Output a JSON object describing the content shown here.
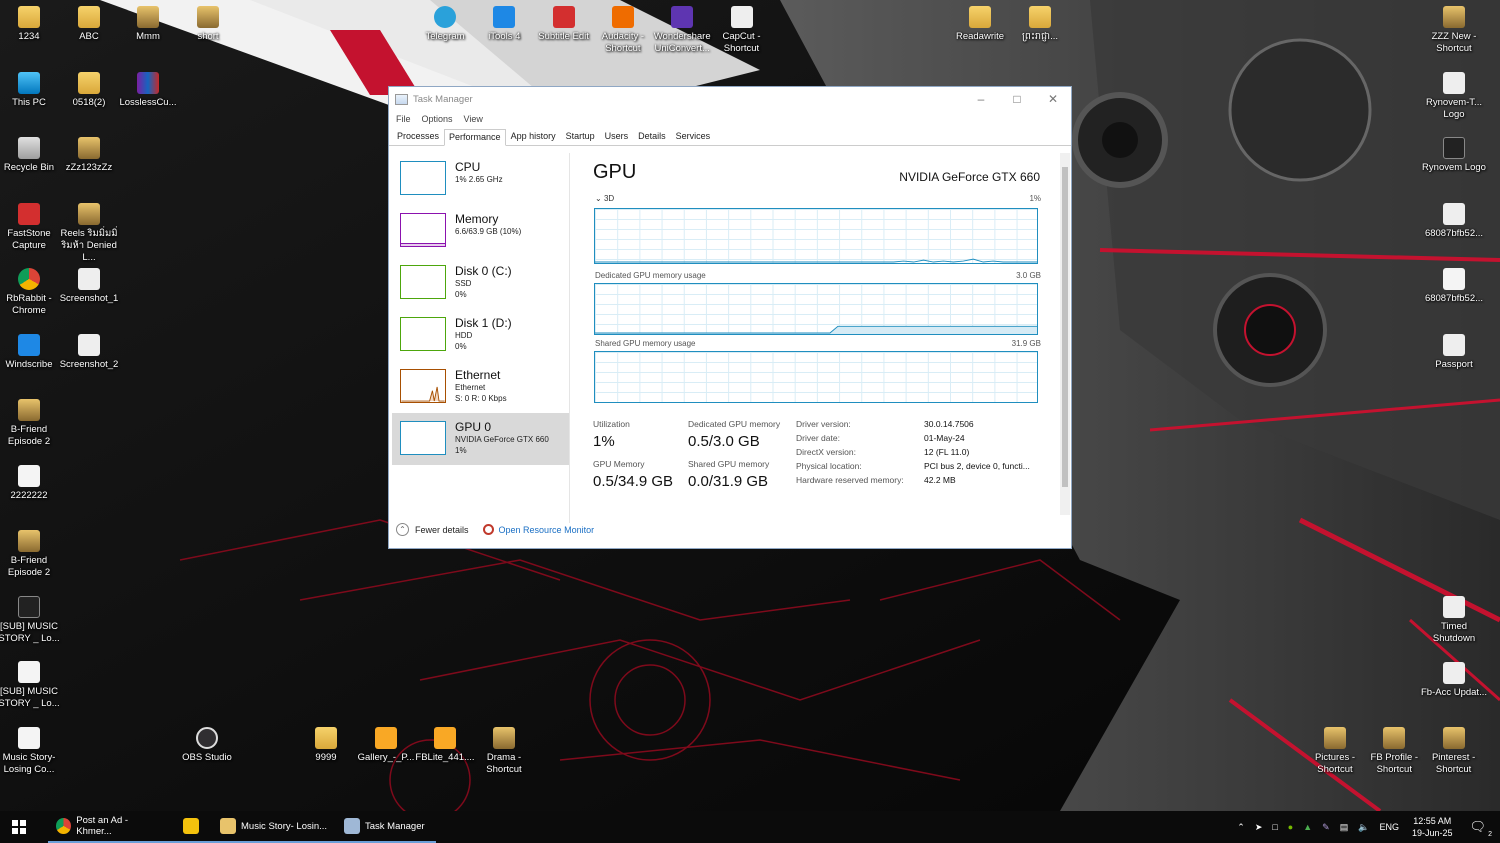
{
  "desktop": {
    "left_icons": [
      {
        "label": "1234",
        "icon": "folder-icon",
        "kind": "folder"
      },
      {
        "label": "This PC",
        "icon": "computer-icon",
        "kind": "pc"
      },
      {
        "label": "Recycle Bin",
        "icon": "recycle-bin-icon",
        "kind": "bin"
      },
      {
        "label": "FastStone Capture",
        "icon": "faststone-icon",
        "kind": "red"
      },
      {
        "label": "RbRabbit - Chrome",
        "icon": "chrome-icon",
        "kind": "chrome"
      },
      {
        "label": "Windscribe",
        "icon": "windscribe-icon",
        "kind": "blue"
      },
      {
        "label": "B-Friend Episode 2",
        "icon": "folder-icon",
        "kind": "folderimg"
      },
      {
        "label": "2222222",
        "icon": "wav-file-icon",
        "kind": "file"
      },
      {
        "label": "B-Friend Episode 2",
        "icon": "folder-icon",
        "kind": "folderimg"
      },
      {
        "label": "[SUB] MUSIC STORY _ Lo...",
        "icon": "video-file-icon",
        "kind": "dark"
      },
      {
        "label": "[SUB] MUSIC STORY _ Lo...",
        "icon": "subtitle-file-icon",
        "kind": "file"
      },
      {
        "label": "Music Story- Losing Co...",
        "icon": "mp3-file-icon",
        "kind": "file"
      }
    ],
    "col2_icons": [
      {
        "label": "ABC",
        "icon": "folder-icon",
        "kind": "folder"
      },
      {
        "label": "0518(2)",
        "icon": "folder-icon",
        "kind": "folder"
      },
      {
        "label": "zZz123zZz",
        "icon": "folder-icon",
        "kind": "folderimg"
      },
      {
        "label": "Reels ริมมิ่มมิ่ริมห้า Denied L...",
        "icon": "folder-icon",
        "kind": "folderimg"
      },
      {
        "label": "Screenshot_1",
        "icon": "image-file-icon",
        "kind": "white"
      },
      {
        "label": "Screenshot_2",
        "icon": "image-file-icon",
        "kind": "white"
      }
    ],
    "col3_icons": [
      {
        "label": "Mmm",
        "icon": "folder-icon",
        "kind": "folderimg"
      },
      {
        "label": "LosslessCu...",
        "icon": "winrar-icon",
        "kind": "winrar"
      }
    ],
    "col4_icons": [
      {
        "label": "short",
        "icon": "folder-icon",
        "kind": "folderimg"
      }
    ],
    "top_icons": [
      {
        "label": "Telegram",
        "icon": "telegram-icon",
        "kind": "tg"
      },
      {
        "label": "iTools 4",
        "icon": "itools-icon",
        "kind": "blue"
      },
      {
        "label": "Subtitle Edit",
        "icon": "subtitle-edit-icon",
        "kind": "red"
      },
      {
        "label": "Audacity - Shortcut",
        "icon": "audacity-icon",
        "kind": "orange"
      },
      {
        "label": "Wondershare UniConvert...",
        "icon": "uniconverter-icon",
        "kind": "purple"
      },
      {
        "label": "CapCut - Shortcut",
        "icon": "capcut-icon",
        "kind": "white"
      }
    ],
    "top_right_icons": [
      {
        "label": "Readawrite",
        "icon": "folder-icon",
        "kind": "folder"
      },
      {
        "label": "ព្រះរាជ្ញា...",
        "icon": "folder-icon",
        "kind": "folder"
      }
    ],
    "right_icons": [
      {
        "label": "ZZZ New - Shortcut",
        "icon": "folder-icon",
        "kind": "folderimg"
      },
      {
        "label": "Rynovem-T... Logo",
        "icon": "logo-file-icon",
        "kind": "white"
      },
      {
        "label": "Rynovem Logo",
        "icon": "logo-file-icon",
        "kind": "dark"
      },
      {
        "label": "68087bfb52...",
        "icon": "file-icon",
        "kind": "white"
      },
      {
        "label": "68087bfb52...",
        "icon": "pdf-icon",
        "kind": "file"
      },
      {
        "label": "Passport",
        "icon": "image-file-icon",
        "kind": "white"
      },
      {
        "label": "Timed Shutdown",
        "icon": "shutdown-icon",
        "kind": "white"
      },
      {
        "label": "Fb-Acc Updat...",
        "icon": "excel-icon",
        "kind": "white"
      }
    ],
    "bottom_icons": [
      {
        "label": "OBS Studio",
        "icon": "obs-icon",
        "kind": "obs"
      },
      {
        "label": "9999",
        "icon": "folder-icon",
        "kind": "folder"
      },
      {
        "label": "Gallery_-_P...",
        "icon": "apk-icon",
        "kind": "apk"
      },
      {
        "label": "FBLite_441....",
        "icon": "apk-icon",
        "kind": "apk"
      },
      {
        "label": "Drama - Shortcut",
        "icon": "folder-icon",
        "kind": "folderimg"
      }
    ],
    "bottom_right_icons": [
      {
        "label": "Pictures - Shortcut",
        "icon": "folder-icon",
        "kind": "folderimg"
      },
      {
        "label": "FB Profile - Shortcut",
        "icon": "folder-icon",
        "kind": "folderimg"
      },
      {
        "label": "Pinterest - Shortcut",
        "icon": "folder-icon",
        "kind": "folderimg"
      }
    ]
  },
  "task_manager": {
    "title": "Task Manager",
    "menu": [
      "File",
      "Options",
      "View"
    ],
    "tabs": [
      "Processes",
      "Performance",
      "App history",
      "Startup",
      "Users",
      "Details",
      "Services"
    ],
    "active_tab": "Performance",
    "resources": [
      {
        "name": "CPU",
        "lines": [
          "1% 2.65 GHz"
        ],
        "color": "#1f8ebf"
      },
      {
        "name": "Memory",
        "lines": [
          "6.6/63.9 GB (10%)"
        ],
        "color": "#8b12ae"
      },
      {
        "name": "Disk 0 (C:)",
        "lines": [
          "SSD",
          "0%"
        ],
        "color": "#4da60c"
      },
      {
        "name": "Disk 1 (D:)",
        "lines": [
          "HDD",
          "0%"
        ],
        "color": "#4da60c"
      },
      {
        "name": "Ethernet",
        "lines": [
          "Ethernet",
          "S: 0 R: 0 Kbps"
        ],
        "color": "#a74f01"
      },
      {
        "name": "GPU 0",
        "lines": [
          "NVIDIA GeForce GTX 660",
          "1%"
        ],
        "color": "#1f8ebf"
      }
    ],
    "gpu": {
      "title": "GPU",
      "model": "NVIDIA GeForce GTX 660",
      "engine_label": "3D",
      "engine_pct": "1%",
      "dedicated_label": "Dedicated GPU memory usage",
      "dedicated_max": "3.0 GB",
      "shared_label": "Shared GPU memory usage",
      "shared_max": "31.9 GB",
      "stats": {
        "utilization_label": "Utilization",
        "utilization": "1%",
        "ded_mem_label": "Dedicated GPU memory",
        "ded_mem": "0.5/3.0 GB",
        "gpu_mem_label": "GPU Memory",
        "gpu_mem": "0.5/34.9 GB",
        "shared_mem_label": "Shared GPU memory",
        "shared_mem": "0.0/31.9 GB"
      },
      "details": [
        {
          "k": "Driver version:",
          "v": "30.0.14.7506"
        },
        {
          "k": "Driver date:",
          "v": "01-May-24"
        },
        {
          "k": "DirectX version:",
          "v": "12 (FL 11.0)"
        },
        {
          "k": "Physical location:",
          "v": "PCI bus 2, device 0, functi..."
        },
        {
          "k": "Hardware reserved memory:",
          "v": "42.2 MB"
        }
      ]
    },
    "footer": {
      "fewer": "Fewer details",
      "open_rm": "Open Resource Monitor"
    }
  },
  "taskbar": {
    "items": [
      {
        "label": "Post an Ad - Khmer...",
        "icon": "chrome-icon",
        "color": "#db4437"
      },
      {
        "label": "",
        "icon": "app-icon",
        "color": "#f4c20d"
      },
      {
        "label": "Music Story- Losin...",
        "icon": "folder-icon",
        "color": "#e8c36b"
      },
      {
        "label": "Task Manager",
        "icon": "task-manager-icon",
        "color": "#9fb8d6"
      }
    ],
    "language": "ENG",
    "time": "12:55 AM",
    "date": "19-Jun-25",
    "notifications": "2"
  },
  "colors": {
    "accent": "#1f8ebf",
    "wallpaper_red": "#c4122f"
  }
}
